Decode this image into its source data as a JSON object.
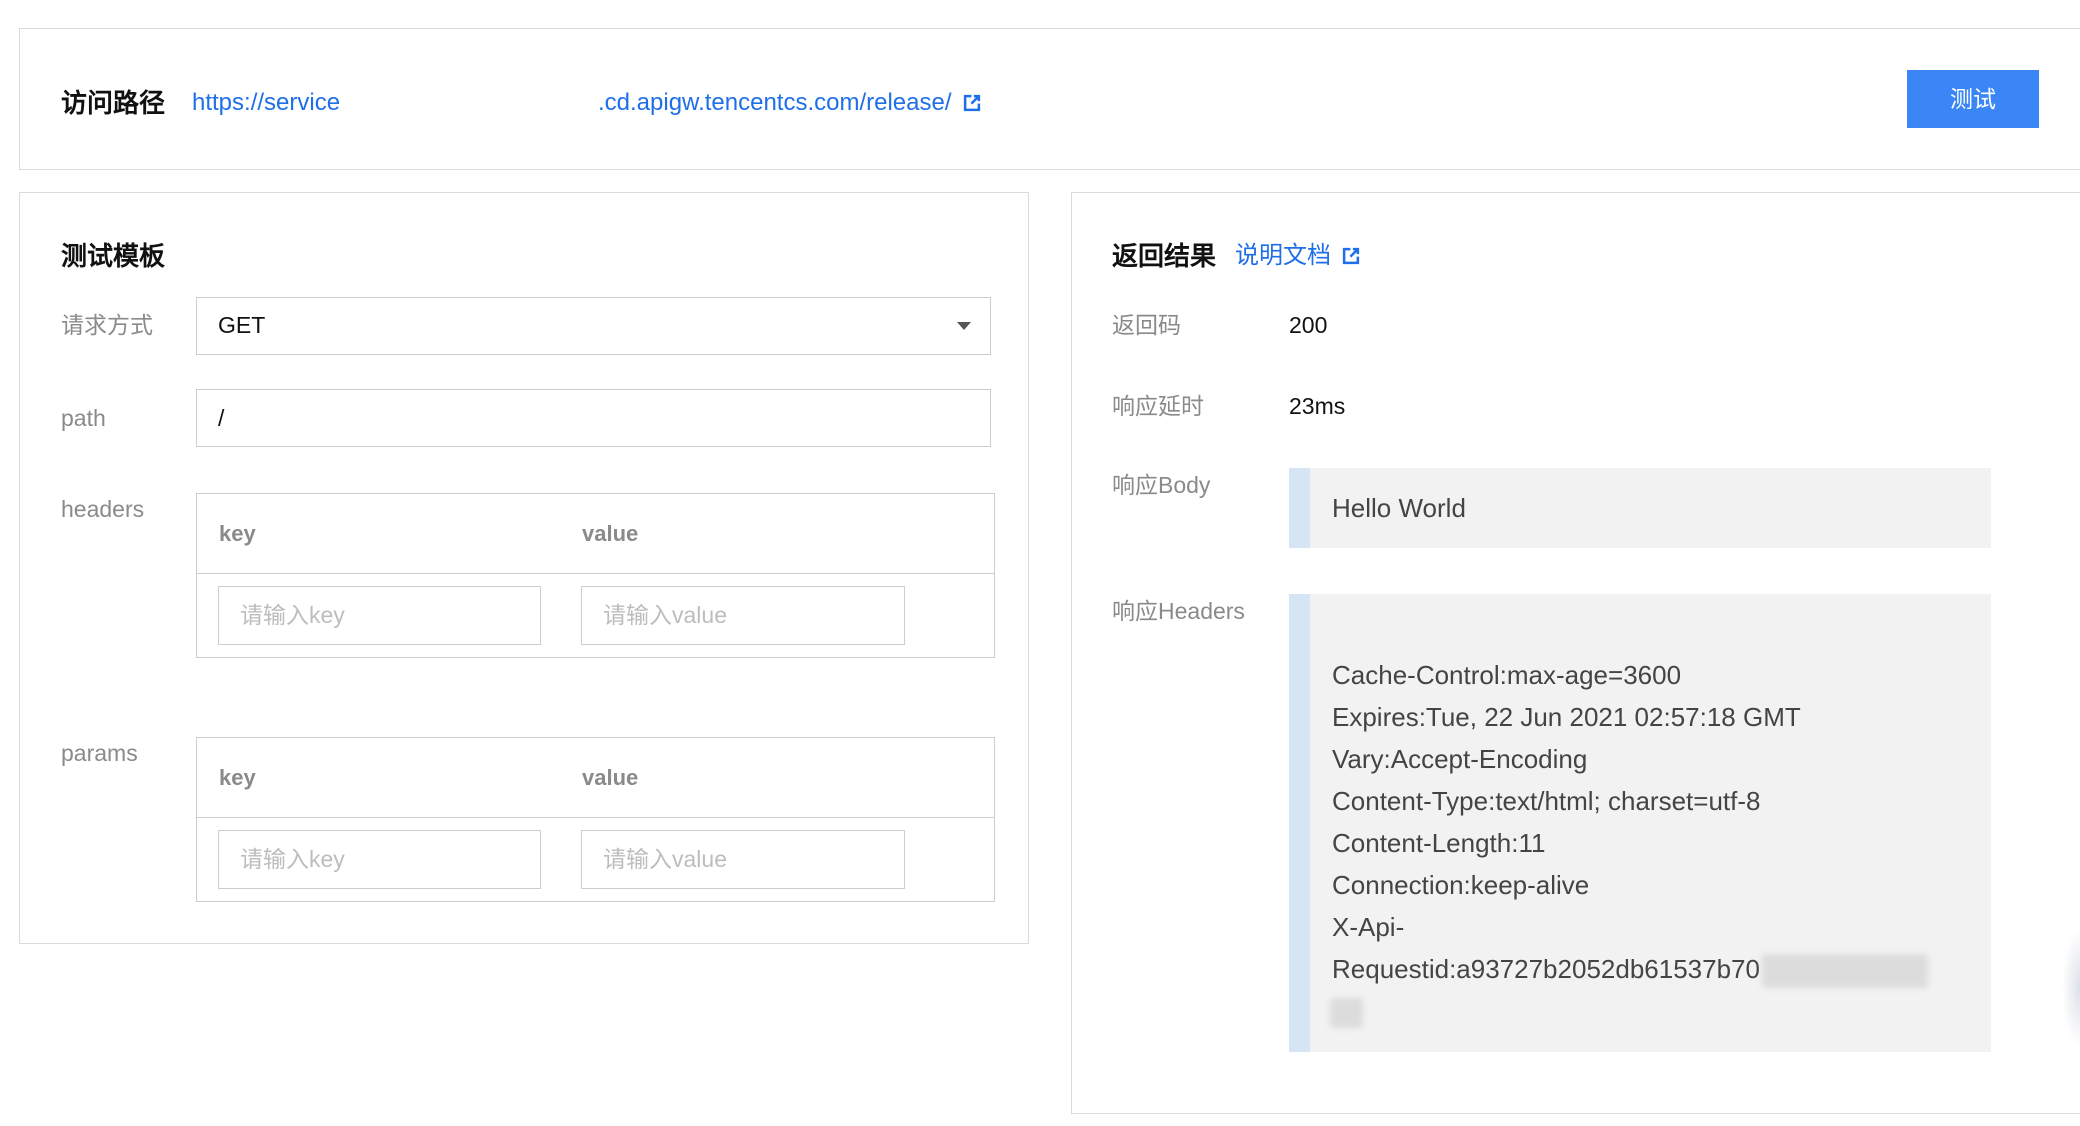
{
  "access_path": {
    "label": "访问路径",
    "url_prefix": "https://service",
    "url_suffix": ".cd.apigw.tencentcs.com/release/",
    "link_icon": "external-link-icon"
  },
  "test_button": {
    "label": "测试"
  },
  "template": {
    "title": "测试模板",
    "method": {
      "label": "请求方式",
      "value": "GET",
      "icon": "chevron-down-icon"
    },
    "path": {
      "label": "path",
      "value": "/"
    },
    "headers": {
      "label": "headers",
      "columns": [
        "key",
        "value"
      ],
      "key_placeholder": "请输入key",
      "value_placeholder": "请输入value"
    },
    "params": {
      "label": "params",
      "columns": [
        "key",
        "value"
      ],
      "key_placeholder": "请输入key",
      "value_placeholder": "请输入value"
    }
  },
  "result": {
    "title": "返回结果",
    "doc_link": "说明文档",
    "doc_link_icon": "external-link-icon",
    "status_code": {
      "label": "返回码",
      "value": "200"
    },
    "latency": {
      "label": "响应延时",
      "value": "23ms"
    },
    "body": {
      "label": "响应Body",
      "value": "Hello World"
    },
    "headers": {
      "label": "响应Headers",
      "lines": [
        "Cache-Control:max-age=3600",
        "Expires:Tue, 22 Jun 2021 02:57:18 GMT",
        "Vary:Accept-Encoding",
        "Content-Type:text/html; charset=utf-8",
        "Content-Length:11",
        "Connection:keep-alive",
        "X-Api-",
        "Requestid:a93727b2052db61537b70"
      ]
    }
  },
  "colors": {
    "accent": "#3a86f7",
    "link": "#1f6fe8",
    "label": "#8a8a8a",
    "code_bar": "#d6e5f5",
    "code_bg": "#f2f2f2"
  }
}
